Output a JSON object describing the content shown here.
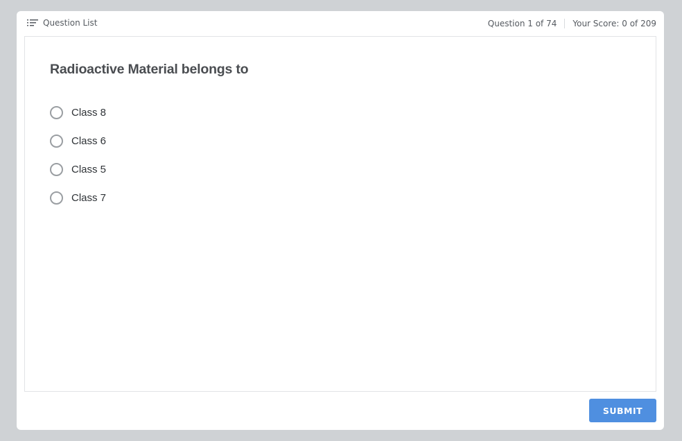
{
  "header": {
    "question_list_label": "Question List",
    "question_counter": "Question 1 of 74",
    "score": "Your Score: 0 of 209"
  },
  "question": {
    "text": "Radioactive Material belongs to",
    "options": [
      {
        "label": "Class 8",
        "selected": false
      },
      {
        "label": "Class 6",
        "selected": false
      },
      {
        "label": "Class 5",
        "selected": false
      },
      {
        "label": "Class 7",
        "selected": false
      }
    ]
  },
  "footer": {
    "submit_label": "SUBMIT"
  },
  "colors": {
    "background": "#cfd2d5",
    "submit_button": "#4f8fe0",
    "radio_border": "#9a9ea2",
    "question_text": "#4a4d51"
  },
  "icons": {
    "question_list": "list-icon"
  }
}
